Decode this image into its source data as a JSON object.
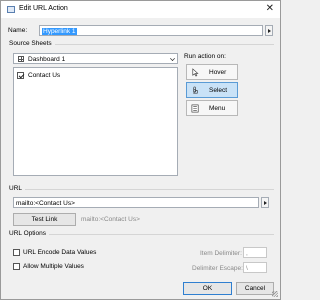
{
  "window": {
    "title": "Edit URL Action"
  },
  "name_field": {
    "label": "Name:",
    "value": "Hyperlink 1"
  },
  "source_sheets": {
    "group_label": "Source Sheets",
    "dashboard": "Dashboard 1",
    "sheets": [
      {
        "label": "Contact Us",
        "checked": true
      }
    ]
  },
  "run_action": {
    "label": "Run action on:",
    "options": [
      {
        "label": "Hover",
        "active": false
      },
      {
        "label": "Select",
        "active": true
      },
      {
        "label": "Menu",
        "active": false
      }
    ]
  },
  "url": {
    "group_label": "URL",
    "value": "mailto:<Contact Us>",
    "test_button": "Test Link",
    "preview": "mailto:<Contact Us>"
  },
  "url_options": {
    "group_label": "URL Options",
    "encode_label": "URL Encode Data Values",
    "multiple_label": "Allow Multiple Values",
    "item_delim_label": "Item Delimiter:",
    "item_delim_value": ",",
    "escape_label": "Delimiter Escape:",
    "escape_value": "\\"
  },
  "footer": {
    "ok": "OK",
    "cancel": "Cancel"
  }
}
